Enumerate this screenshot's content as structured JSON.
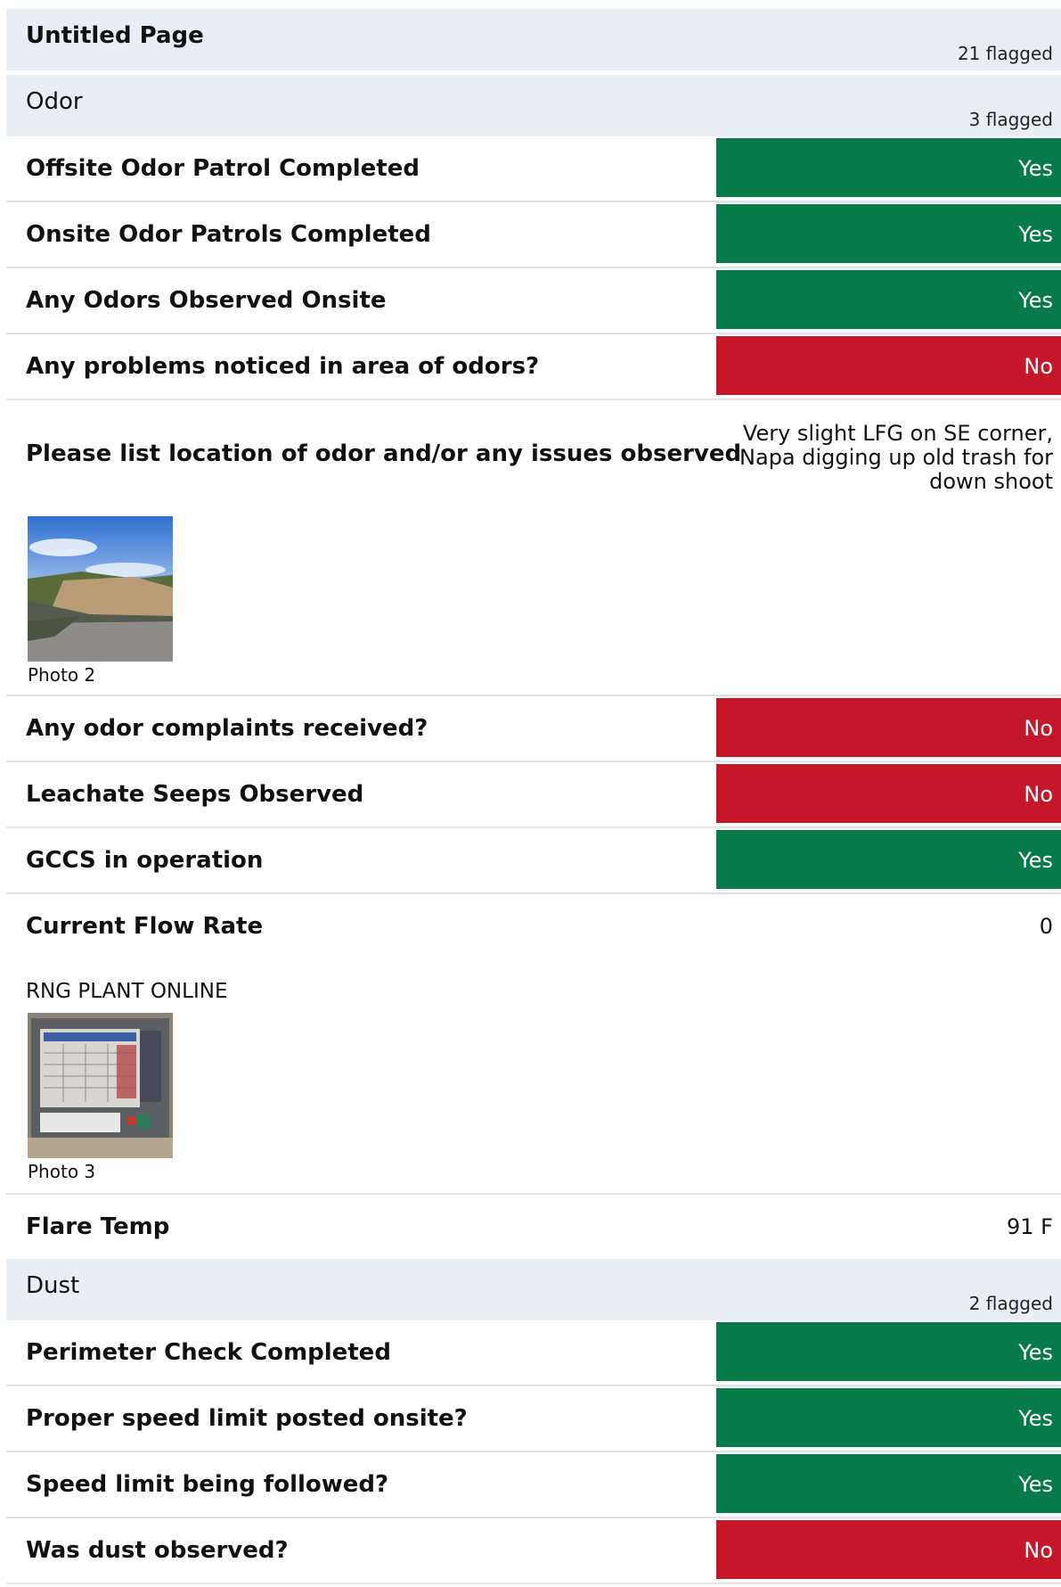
{
  "page": {
    "title": "Untitled Page",
    "flagged": "21 flagged"
  },
  "sections": {
    "odor": {
      "title": "Odor",
      "flagged": "3 flagged",
      "offsite_patrol": {
        "question": "Offsite Odor Patrol Completed",
        "answer": "Yes"
      },
      "onsite_patrols": {
        "question": "Onsite Odor Patrols Completed",
        "answer": "Yes"
      },
      "odors_observed": {
        "question": "Any Odors Observed Onsite",
        "answer": "Yes"
      },
      "problems_noticed": {
        "question": "Any problems noticed in area of odors?",
        "answer": "No"
      },
      "odor_location": {
        "question": "Please list location of odor and/or any issues observed",
        "answer": "Very slight LFG on SE corner, Napa digging up old trash for down shoot",
        "photo_caption": "Photo 2"
      },
      "complaints": {
        "question": "Any odor complaints received?",
        "answer": "No"
      },
      "leachate": {
        "question": "Leachate Seeps Observed",
        "answer": "No"
      },
      "gccs": {
        "question": "GCCS in operation",
        "answer": "Yes"
      },
      "flow_rate": {
        "question": "Current Flow Rate",
        "answer": "0",
        "note": "RNG PLANT ONLINE",
        "photo_caption": "Photo 3"
      },
      "flare_temp": {
        "question": "Flare Temp",
        "answer": "91 F"
      }
    },
    "dust": {
      "title": "Dust",
      "flagged": "2 flagged",
      "perimeter": {
        "question": "Perimeter Check Completed",
        "answer": "Yes"
      },
      "speed_posted": {
        "question": "Proper speed limit posted onsite?",
        "answer": "Yes"
      },
      "speed_followed": {
        "question": "Speed limit being followed?",
        "answer": "Yes"
      },
      "dust_observed": {
        "question": "Was dust observed?",
        "answer": "No"
      }
    }
  },
  "colors": {
    "yes": "#067a48",
    "no": "#c4182a",
    "header_bg": "#e9eef5"
  },
  "images": {
    "photo2": "landscape photo: blue sky with clouds, grassy hillside with dirt slope, gravel road",
    "photo3": "photo of a control panel display screen in a grey enclosure"
  }
}
